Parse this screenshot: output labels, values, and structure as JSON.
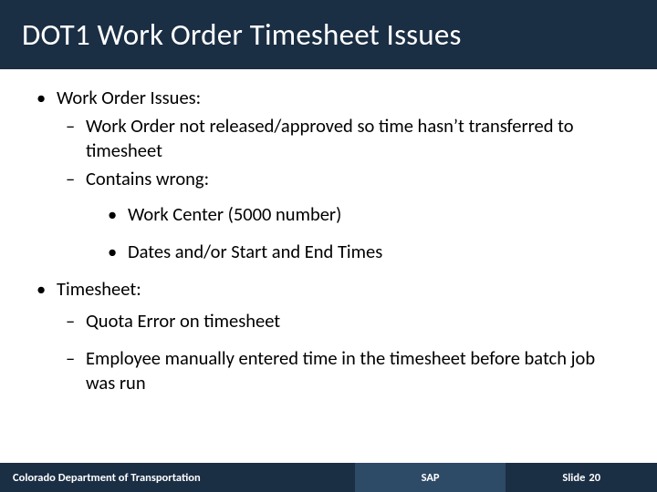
{
  "title": "DOT1 Work Order Timesheet Issues",
  "bullets": {
    "b1": "Work Order Issues:",
    "b1_1": "Work Order not released/approved so time hasn’t transferred to timesheet",
    "b1_2": "Contains wrong:",
    "b1_2_1": "Work Center (5000 number)",
    "b1_2_2": "Dates and/or Start and End Times",
    "b2": "Timesheet:",
    "b2_1": "Quota Error on timesheet",
    "b2_2": "Employee manually entered time in the timesheet before batch job was run"
  },
  "footer": {
    "org": "Colorado Department of Transportation",
    "system": "SAP",
    "slide_label": "Slide",
    "slide_number": "20"
  }
}
